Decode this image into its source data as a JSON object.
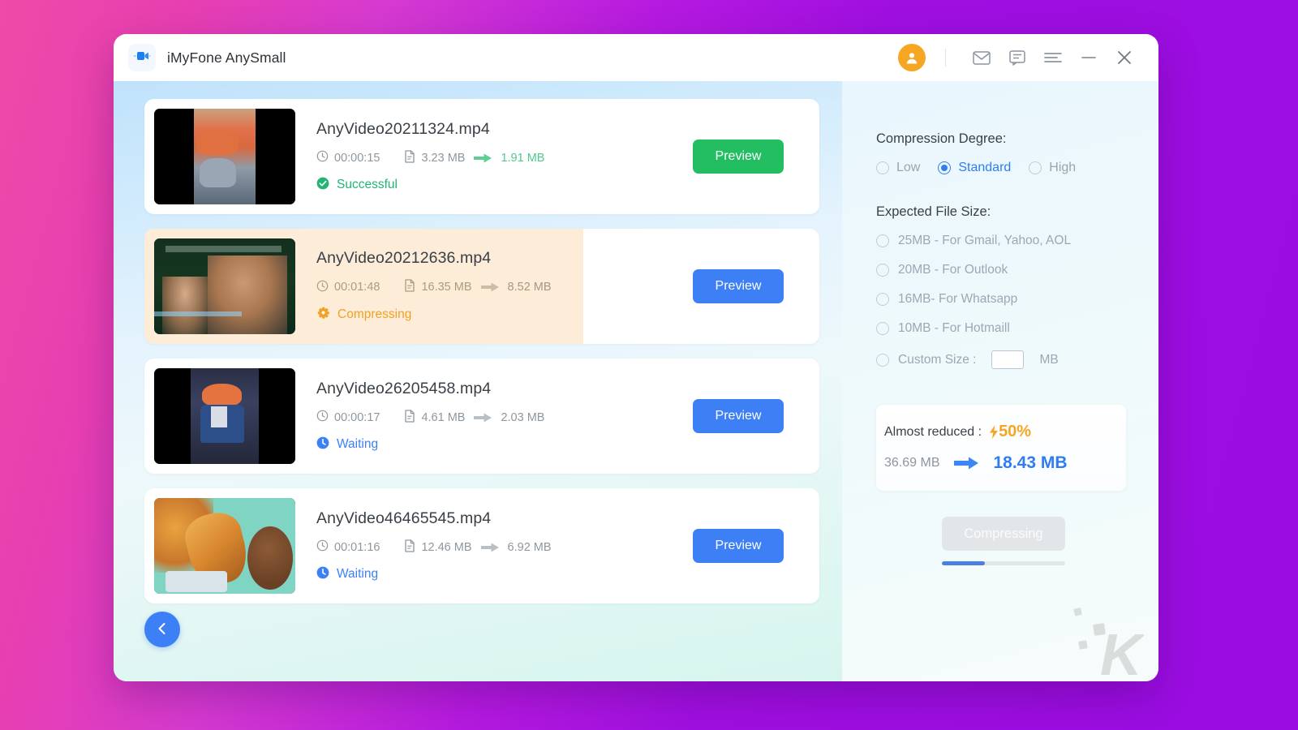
{
  "window": {
    "app_title": "iMyFone AnySmall",
    "logo_icon": "video-camera-icon",
    "controls": {
      "avatar_icon": "user-avatar-icon",
      "mail_icon": "mail-icon",
      "feedback_icon": "chat-message-icon",
      "menu_icon": "hamburger-menu-icon",
      "minimize_icon": "minimize-icon",
      "close_icon": "close-icon"
    },
    "accent_blue": "#3d7ff5",
    "accent_green": "#23bd62",
    "accent_orange": "#f5a623"
  },
  "file_list": {
    "back_button_icon": "chevron-left-icon",
    "items": [
      {
        "filename": "AnyVideo20211324.mp4",
        "duration": "00:00:15",
        "size_in": "3.23 MB",
        "size_out": "1.91 MB",
        "status": "Successful",
        "status_kind": "success",
        "status_icon": "check-circle-icon",
        "button_label": "Preview",
        "button_kind": "green",
        "progress_percent": 100,
        "highlight": false
      },
      {
        "filename": "AnyVideo20212636.mp4",
        "duration": "00:01:48",
        "size_in": "16.35 MB",
        "size_out": "8.52 MB",
        "status": "Compressing",
        "status_kind": "compressing",
        "status_icon": "gear-icon",
        "button_label": "Preview",
        "button_kind": "blue",
        "progress_percent": 65,
        "highlight": true
      },
      {
        "filename": "AnyVideo26205458.mp4",
        "duration": "00:00:17",
        "size_in": "4.61 MB",
        "size_out": "2.03 MB",
        "status": "Waiting",
        "status_kind": "waiting",
        "status_icon": "clock-circle-icon",
        "button_label": "Preview",
        "button_kind": "blue",
        "progress_percent": 0,
        "highlight": false
      },
      {
        "filename": "AnyVideo46465545.mp4",
        "duration": "00:01:16",
        "size_in": "12.46 MB",
        "size_out": "6.92 MB",
        "status": "Waiting",
        "status_kind": "waiting",
        "status_icon": "clock-circle-icon",
        "button_label": "Preview",
        "button_kind": "blue",
        "progress_percent": 0,
        "highlight": false
      }
    ],
    "meta_icons": {
      "duration_icon": "clock-icon",
      "file_icon": "file-icon",
      "arrow_icon": "arrow-right-icon"
    }
  },
  "settings": {
    "compression_label": "Compression Degree:",
    "degrees": [
      {
        "label": "Low",
        "selected": false
      },
      {
        "label": "Standard",
        "selected": true
      },
      {
        "label": "High",
        "selected": false
      }
    ],
    "expected_label": "Expected File Size:",
    "sizes": [
      {
        "label": "25MB - For Gmail, Yahoo, AOL",
        "selected": false
      },
      {
        "label": "20MB - For Outlook",
        "selected": false
      },
      {
        "label": "16MB- For Whatsapp",
        "selected": false
      },
      {
        "label": "10MB - For Hotmaill",
        "selected": false
      }
    ],
    "custom": {
      "label": "Custom Size :",
      "value": "",
      "placeholder": "",
      "unit": "MB",
      "selected": false
    },
    "summary": {
      "reduced_label": "Almost reduced :",
      "reduced_percent": "50%",
      "bolt_icon": "lightning-bolt-icon",
      "size_before": "36.69 MB",
      "size_after": "18.43 MB",
      "arrow_icon": "arrow-right-icon"
    },
    "action": {
      "button_label": "Compressing",
      "button_disabled": true,
      "progress_percent": 35
    }
  },
  "watermark": {
    "letter": "K"
  }
}
